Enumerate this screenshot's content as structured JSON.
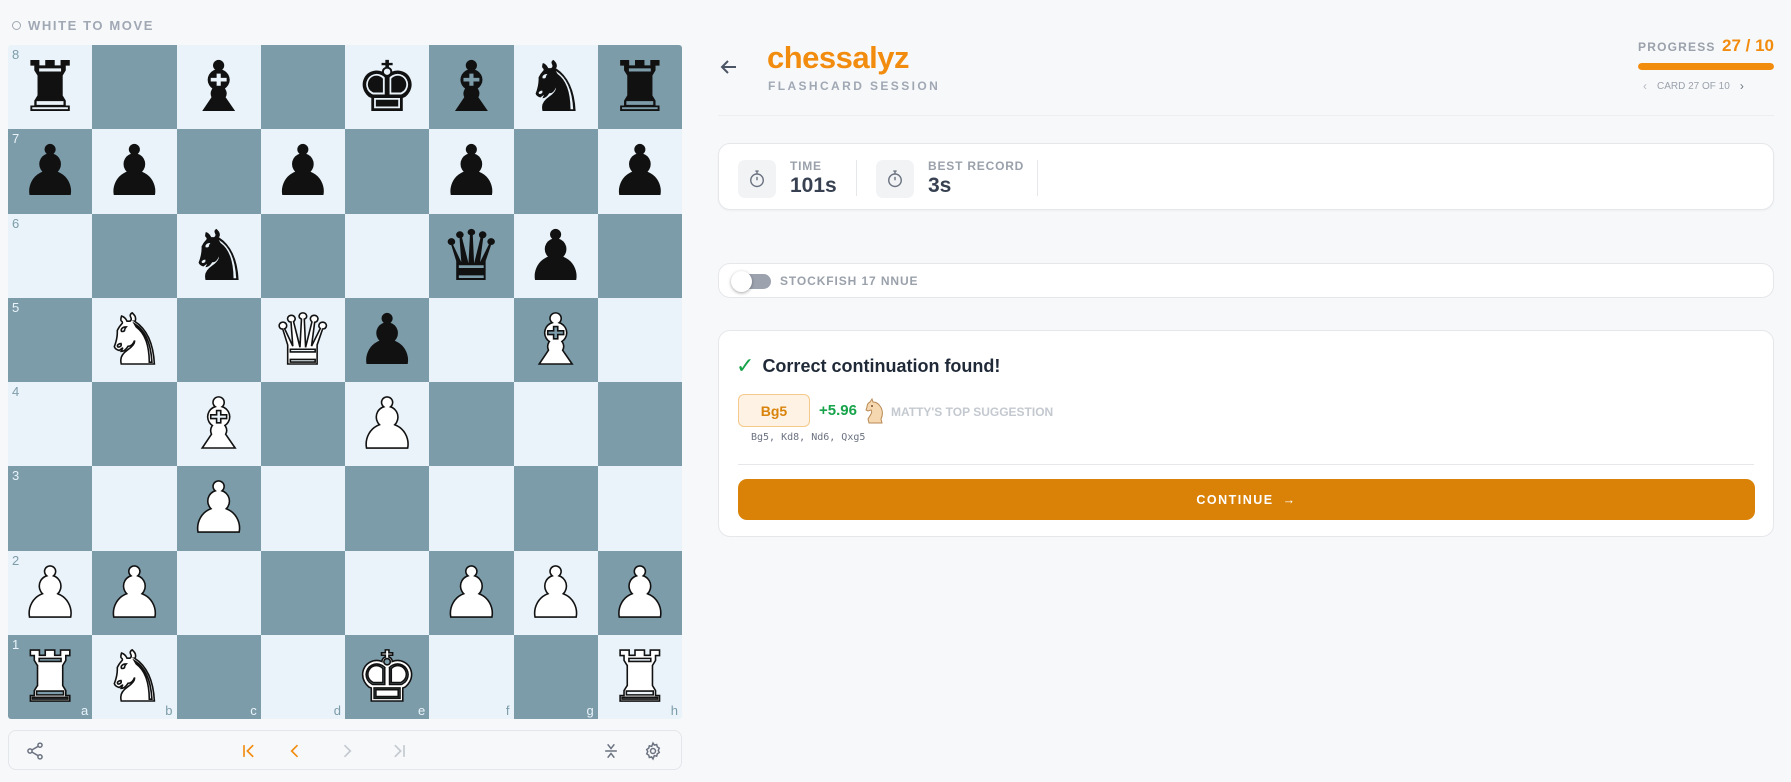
{
  "turn": {
    "label": "WHITE TO MOVE"
  },
  "board": {
    "files": [
      "a",
      "b",
      "c",
      "d",
      "e",
      "f",
      "g",
      "h"
    ],
    "ranks": [
      "8",
      "7",
      "6",
      "5",
      "4",
      "3",
      "2",
      "1"
    ],
    "squares": [
      [
        "bR",
        "",
        "bB",
        "",
        "bK",
        "bB",
        "bN",
        "bR"
      ],
      [
        "bP",
        "bP",
        "",
        "bP",
        "",
        "bP",
        "",
        "bP"
      ],
      [
        "",
        "",
        "bN",
        "",
        "",
        "bQ",
        "bP",
        ""
      ],
      [
        "",
        "wN",
        "",
        "wQ",
        "bP",
        "",
        "wB",
        ""
      ],
      [
        "",
        "",
        "wB",
        "",
        "wP",
        "",
        "",
        ""
      ],
      [
        "",
        "",
        "wP",
        "",
        "",
        "",
        "",
        ""
      ],
      [
        "wP",
        "wP",
        "",
        "",
        "",
        "wP",
        "wP",
        "wP"
      ],
      [
        "wR",
        "wN",
        "",
        "",
        "wK",
        "",
        "",
        "wR"
      ]
    ],
    "glyphs": {
      "K": "♚",
      "Q": "♛",
      "R": "♜",
      "B": "♝",
      "N": "♞",
      "P": "♟"
    }
  },
  "toolbar": {
    "icons": [
      "share-icon",
      "first-move-icon",
      "prev-move-icon",
      "next-move-icon",
      "last-move-icon",
      "flip-board-icon",
      "settings-icon"
    ]
  },
  "header": {
    "logo": "chessalyz",
    "subtitle": "FLASHCARD SESSION",
    "progress_label": "PROGRESS",
    "progress_value": "27 / 10",
    "progress_fraction": 1.0,
    "card_label": "CARD 27 OF 10"
  },
  "stats": {
    "time_label": "TIME",
    "time_value": "101s",
    "best_label": "BEST RECORD",
    "best_value": "3s"
  },
  "engine": {
    "label": "STOCKFISH 17 NNUE",
    "enabled": false
  },
  "result": {
    "title": "Correct continuation found!",
    "check": "✓",
    "move": "Bg5",
    "eval": "+5.96",
    "suggestion": "MATTY'S TOP SUGGESTION",
    "line": "Bg5, Kd8, Nd6, Qxg5",
    "continue_label": "CONTINUE",
    "continue_arrow": "→"
  },
  "colors": {
    "accent": "#f28c0f",
    "continue_button": "#d98207",
    "success": "#16a34a",
    "light_square": "#e9f3f9",
    "dark_square": "#7d9caa"
  }
}
